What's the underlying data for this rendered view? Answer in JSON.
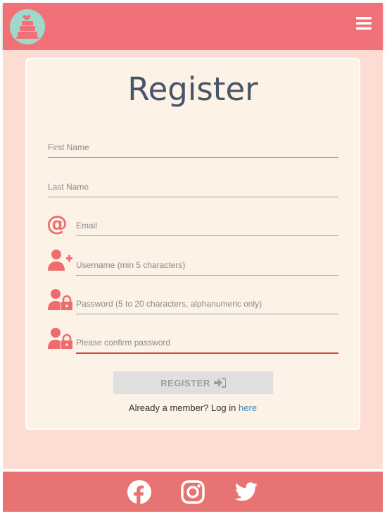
{
  "form": {
    "title": "Register",
    "first_name_placeholder": "First Name",
    "last_name_placeholder": "Last Name",
    "email_placeholder": "Email",
    "username_placeholder": "Username (min 5 characters)",
    "password_placeholder": "Password (5 to 20 characters, alphanumeric only)",
    "confirm_placeholder": "Please confirm password",
    "register_label": "REGISTER",
    "login_prompt": "Already a member? Log in",
    "login_link": "here"
  },
  "icons": {
    "logo": "cake-icon",
    "menu": "hamburger-menu-icon",
    "email": "at-sign-icon",
    "username": "user-plus-icon",
    "password": "user-lock-icon",
    "confirm": "user-lock-icon",
    "register": "sign-in-icon",
    "social": [
      "facebook-icon",
      "instagram-icon",
      "twitter-icon"
    ]
  },
  "colors": {
    "navbar": "#f07177",
    "footer": "#e87373",
    "page_bg": "#fddcd3",
    "card_bg": "#fcf2e6",
    "icon": "#ee6b6e",
    "title": "#475469",
    "link": "#3d85c6",
    "active_underline": "#e0453c"
  }
}
